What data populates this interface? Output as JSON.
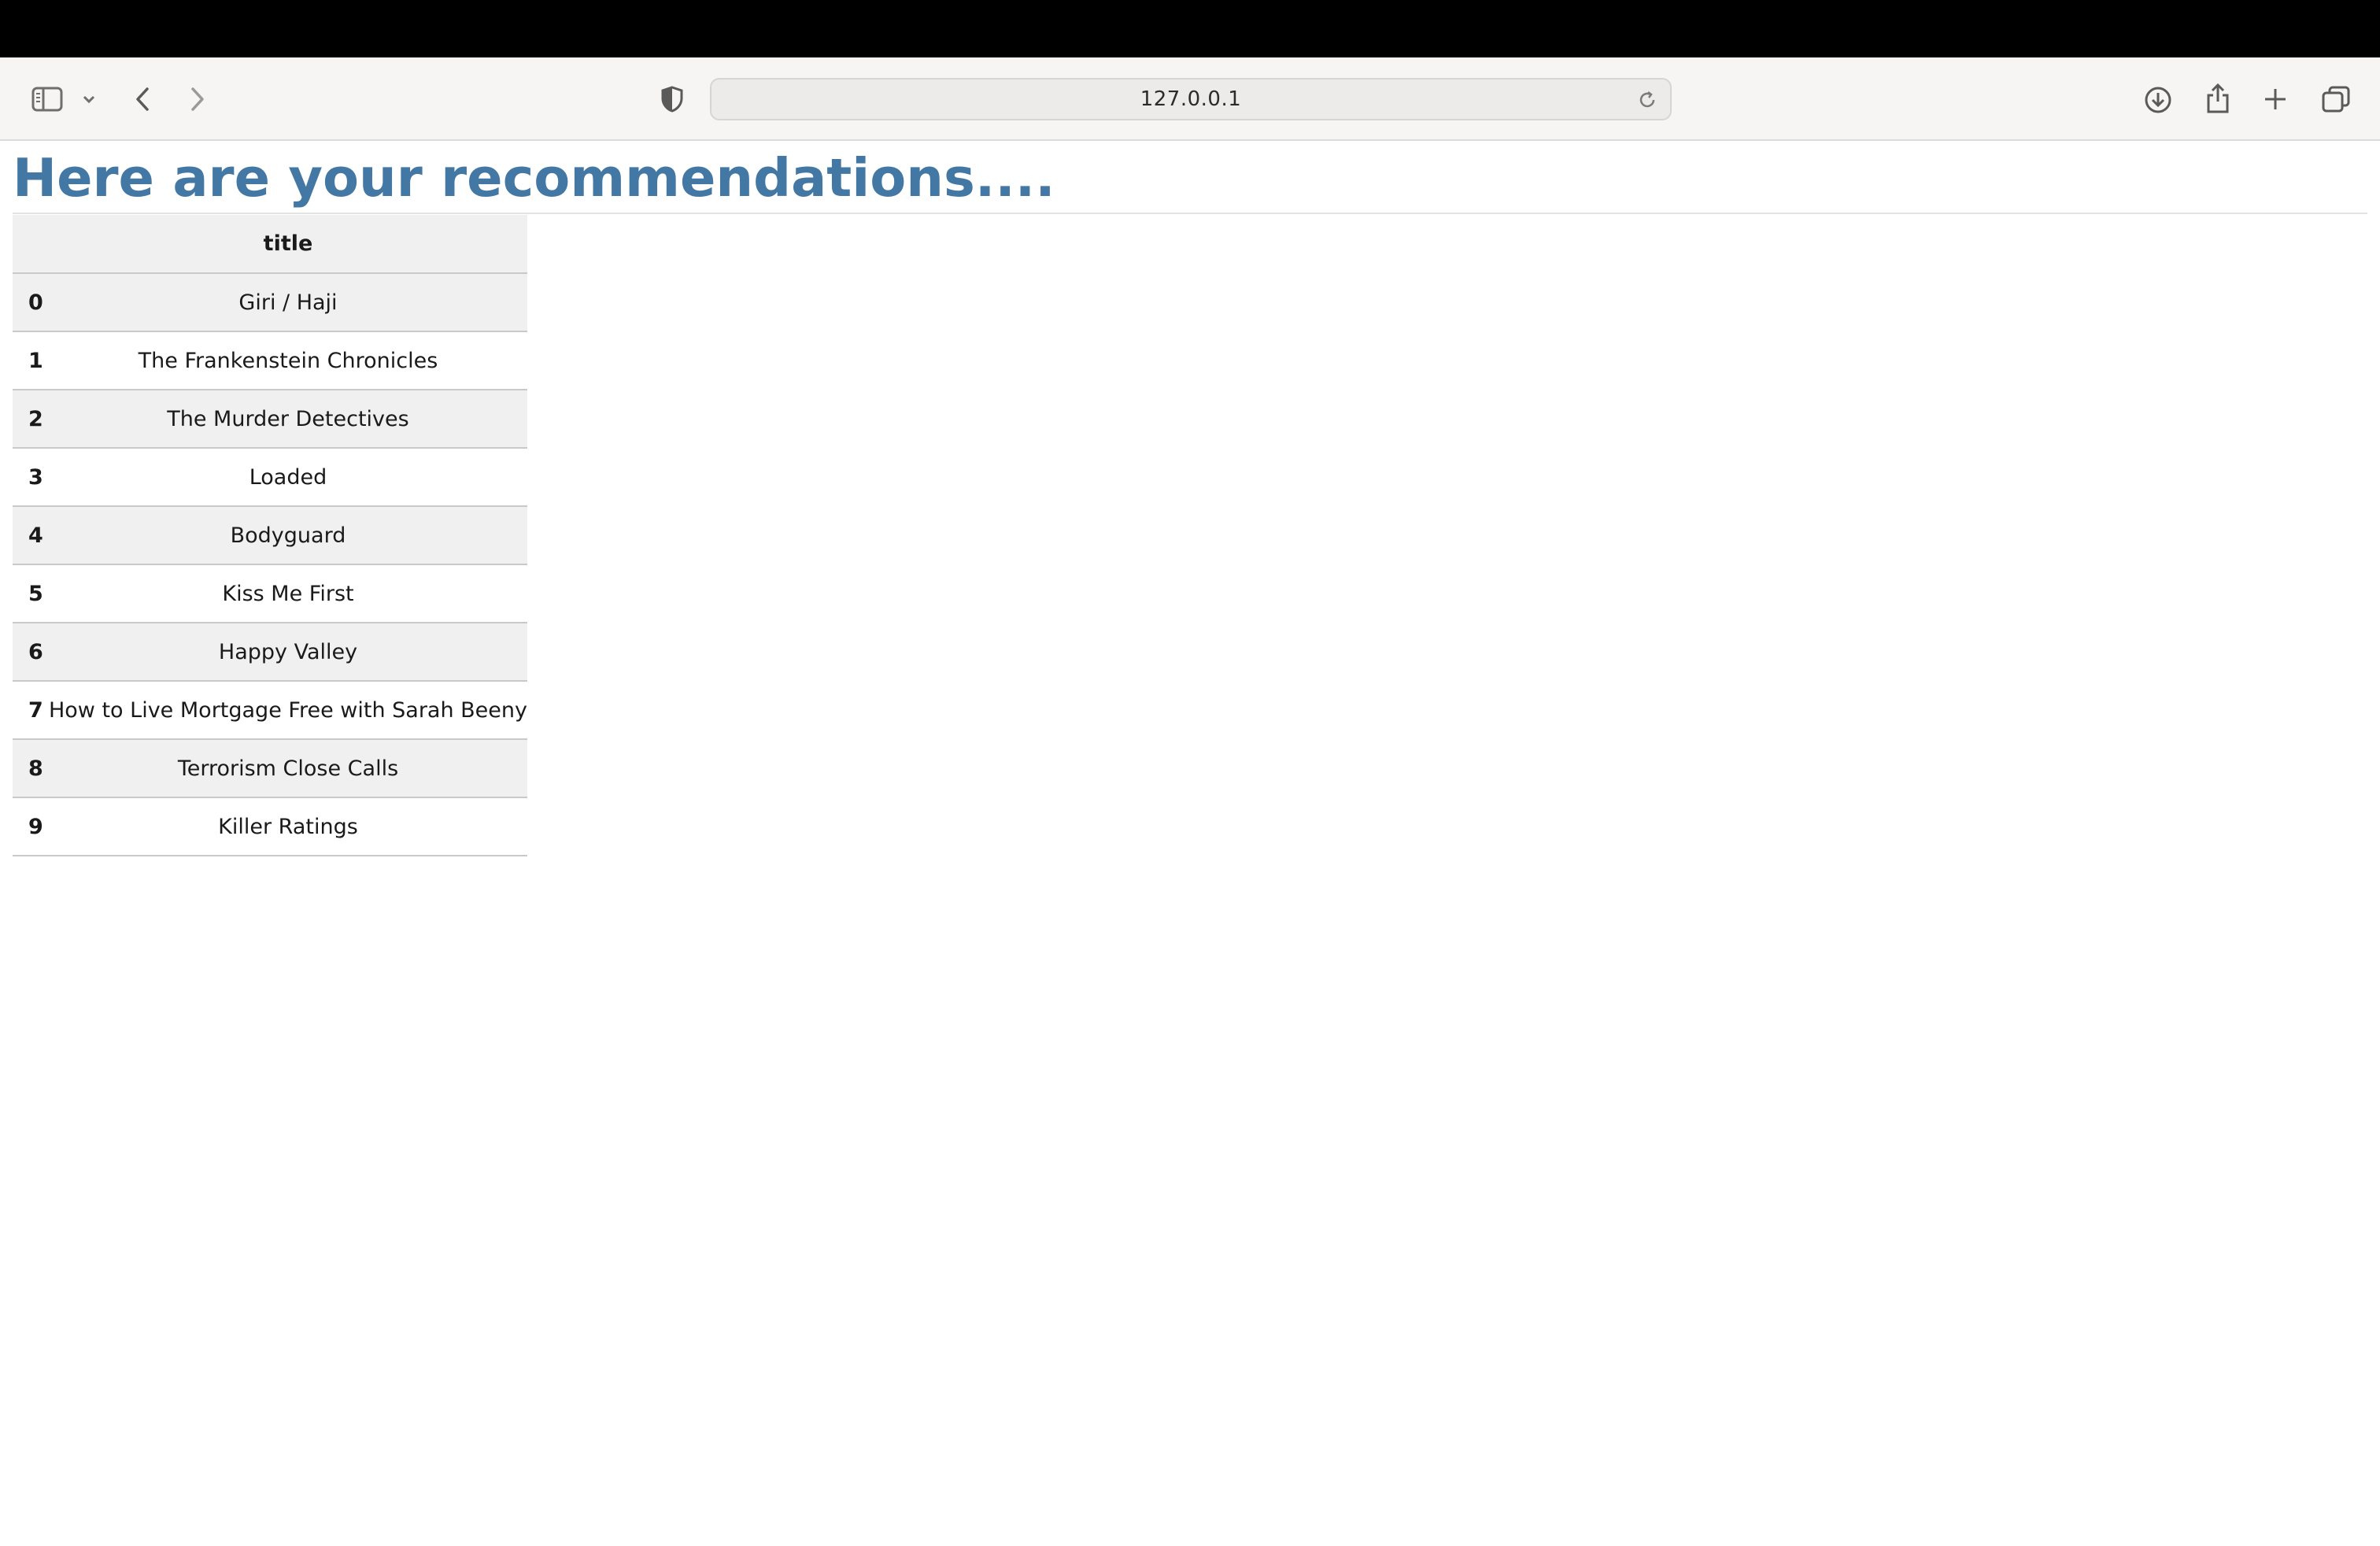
{
  "browser": {
    "url": "127.0.0.1",
    "icons": [
      "sidebar-icon",
      "chevron-down-icon",
      "back-icon",
      "forward-icon",
      "shield-icon",
      "reload-icon",
      "download-icon",
      "share-icon",
      "plus-icon",
      "tabs-overview-icon"
    ]
  },
  "page": {
    "heading": "Here are your recommendations....",
    "table": {
      "index_header": "",
      "column_header": "title",
      "rows": [
        {
          "index": "0",
          "title": "Giri / Haji"
        },
        {
          "index": "1",
          "title": "The Frankenstein Chronicles"
        },
        {
          "index": "2",
          "title": "The Murder Detectives"
        },
        {
          "index": "3",
          "title": "Loaded"
        },
        {
          "index": "4",
          "title": "Bodyguard"
        },
        {
          "index": "5",
          "title": "Kiss Me First"
        },
        {
          "index": "6",
          "title": "Happy Valley"
        },
        {
          "index": "7",
          "title": "How to Live Mortgage Free with Sarah Beeny"
        },
        {
          "index": "8",
          "title": "Terrorism Close Calls"
        },
        {
          "index": "9",
          "title": "Killer Ratings"
        }
      ]
    }
  },
  "colors": {
    "heading": "#4377a4",
    "striped_row": "#f0f0f0",
    "toolbar": "#f6f5f4"
  }
}
